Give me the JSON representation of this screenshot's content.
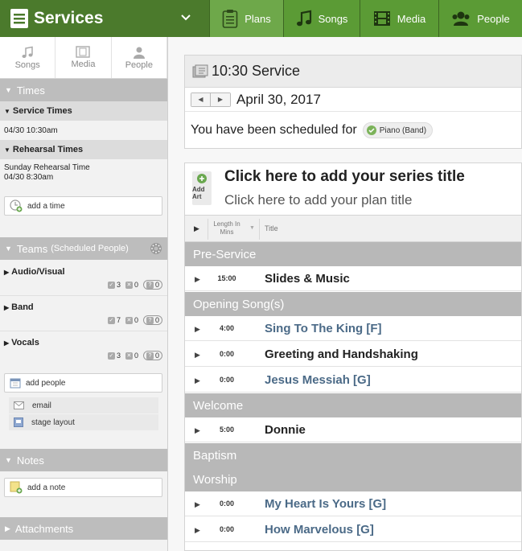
{
  "app": {
    "title": "Services"
  },
  "topnav": {
    "tabs": [
      {
        "label": "Plans",
        "icon": "clipboard-icon"
      },
      {
        "label": "Songs",
        "icon": "music-note-icon"
      },
      {
        "label": "Media",
        "icon": "film-icon"
      },
      {
        "label": "People",
        "icon": "people-icon"
      }
    ]
  },
  "sidebar": {
    "tabs": [
      {
        "label": "Songs",
        "icon": "music-note-icon"
      },
      {
        "label": "Media",
        "icon": "film-icon"
      },
      {
        "label": "People",
        "icon": "person-icon"
      }
    ],
    "times": {
      "header": "Times",
      "service_label": "Service Times",
      "service_time": "04/30 10:30am",
      "rehearsal_label": "Rehearsal Times",
      "rehearsal_name": "Sunday Rehearsal Time",
      "rehearsal_time": "04/30 8:30am",
      "add_time": "add a time"
    },
    "teams": {
      "header": "Teams",
      "subheader": "(Scheduled People)",
      "list": [
        {
          "name": "Audio/Visual",
          "confirmed": "3",
          "declined": "0",
          "unconfirmed": "0"
        },
        {
          "name": "Band",
          "confirmed": "7",
          "declined": "0",
          "unconfirmed": "0"
        },
        {
          "name": "Vocals",
          "confirmed": "3",
          "declined": "0",
          "unconfirmed": "0"
        }
      ],
      "add_people": "add people",
      "email": "email",
      "stage_layout": "stage layout"
    },
    "notes": {
      "header": "Notes",
      "add_note": "add a note"
    },
    "attachments": {
      "header": "Attachments"
    }
  },
  "service": {
    "name": "10:30 Service",
    "date": "April 30, 2017",
    "scheduled_text": "You have been scheduled for",
    "badge": "Piano (Band)"
  },
  "plan": {
    "add_art": "Add Art",
    "series_title": "Click here to add your series title",
    "plan_title": "Click here to add your plan title",
    "columns": {
      "length_line1": "Length In",
      "length_line2": "Mins",
      "title": "Title"
    },
    "rows": [
      {
        "type": "header",
        "title": "Pre-Service"
      },
      {
        "type": "item",
        "length": "15:00",
        "title": "Slides & Music",
        "song": false
      },
      {
        "type": "header",
        "title": "Opening Song(s)"
      },
      {
        "type": "item",
        "length": "4:00",
        "title": "Sing To The King [F]",
        "song": true
      },
      {
        "type": "item",
        "length": "0:00",
        "title": "Greeting and Handshaking",
        "song": false
      },
      {
        "type": "item",
        "length": "0:00",
        "title": "Jesus Messiah [G]",
        "song": true
      },
      {
        "type": "header",
        "title": "Welcome"
      },
      {
        "type": "item",
        "length": "5:00",
        "title": "Donnie",
        "song": false
      },
      {
        "type": "header",
        "title": "Baptism"
      },
      {
        "type": "header",
        "title": "Worship"
      },
      {
        "type": "item",
        "length": "0:00",
        "title": "My Heart Is Yours [G]",
        "song": true
      },
      {
        "type": "item",
        "length": "0:00",
        "title": "How Marvelous [G]",
        "song": true
      }
    ]
  },
  "colors": {
    "topbar": "#4b7a2c",
    "tab_active": "#6ea84a",
    "section_header": "#b8b8b8",
    "song_link": "#4b6a87"
  }
}
